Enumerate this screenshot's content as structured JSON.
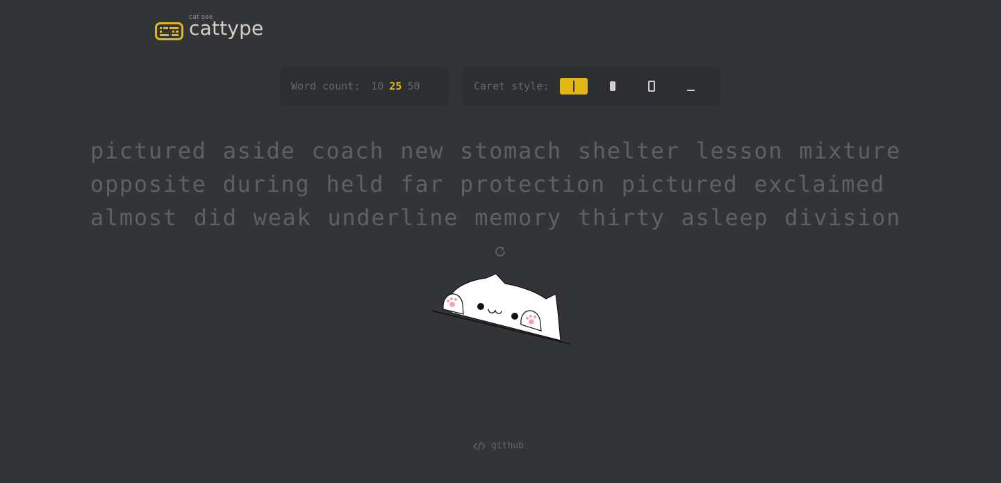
{
  "header": {
    "logo_subtitle": "cat see",
    "logo_title": "cattype"
  },
  "word_count": {
    "label": "Word count:",
    "options": [
      "10",
      "25",
      "50"
    ],
    "selected": "25"
  },
  "caret_style": {
    "label": "Caret style:",
    "options": [
      "line",
      "block",
      "outline-block",
      "underline"
    ],
    "selected": "line"
  },
  "test": {
    "lines": [
      "pictured aside coach new stomach shelter lesson mixture",
      "opposite during held far protection pictured exclaimed",
      "almost did weak underline memory thirty asleep division"
    ]
  },
  "restart": {
    "icon": "restart-icon"
  },
  "footer": {
    "github_label": "github",
    "icon": "code-icon"
  },
  "colors": {
    "background": "#323437",
    "panel": "#2c2e31",
    "accent": "#e2b714",
    "text_untyped": "#5e6064",
    "text_main": "#d1d0c5"
  }
}
